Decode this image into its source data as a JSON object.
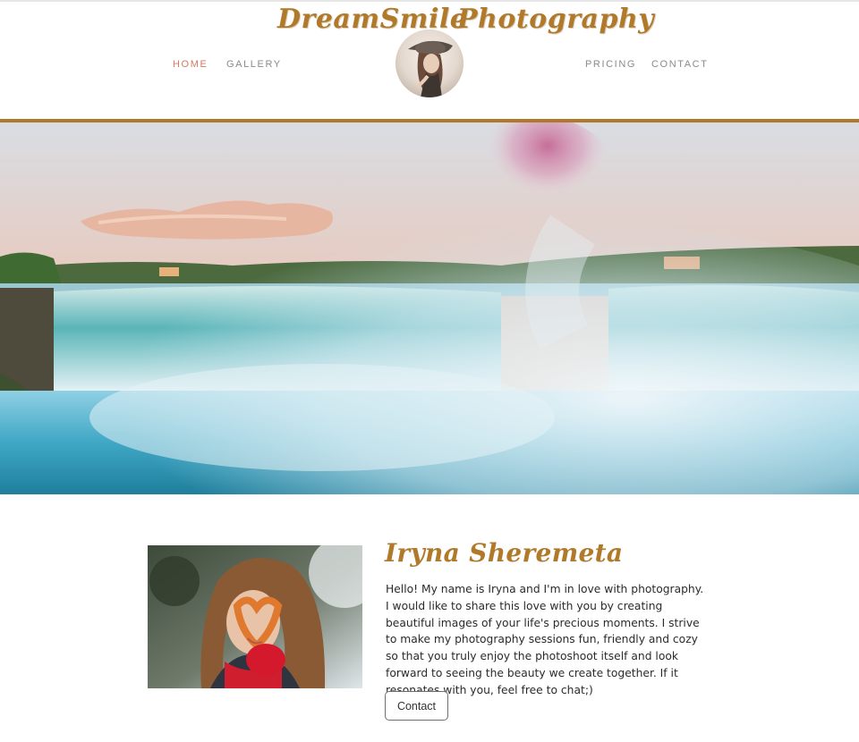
{
  "brand": {
    "name_left": "DreamSmile",
    "name_right": "Photography"
  },
  "nav": {
    "items": [
      {
        "label": "HOME",
        "active": true
      },
      {
        "label": "GALLERY",
        "active": false
      },
      {
        "label": "PRICING",
        "active": false
      },
      {
        "label": "CONTACT",
        "active": false
      }
    ]
  },
  "colors": {
    "brand_gold": "#b07a2a",
    "nav_active": "#d97761",
    "nav_inactive": "#8b8b8b"
  },
  "about": {
    "name": "Iryna Sheremeta",
    "text": "Hello! My name is Iryna and I'm in love with photography. I would like to share this love with you by creating beautiful images of your life's precious moments. I strive to make my photography sessions fun, friendly and cozy so that you truly enjoy the photoshoot itself and look forward to seeing the beauty we create together. If it resonates with you, feel free to chat;)",
    "button_label": "Contact"
  }
}
